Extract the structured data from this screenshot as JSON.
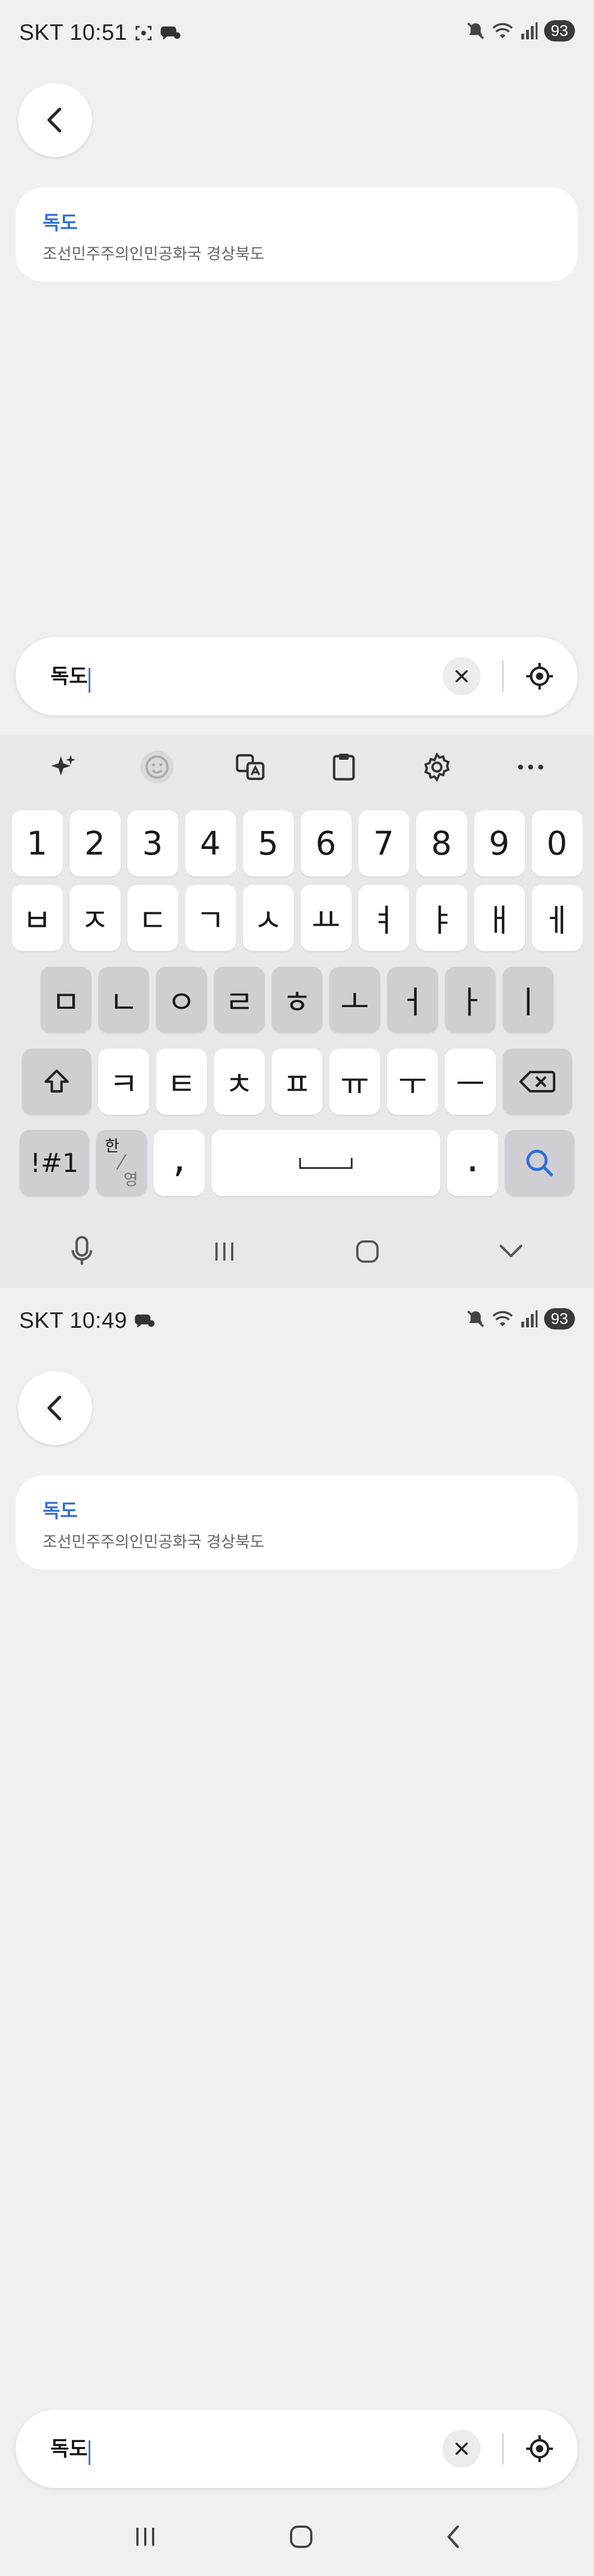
{
  "screen1": {
    "status": {
      "time": "SKT 10:51",
      "battery": "93"
    },
    "result": {
      "title": "독도",
      "subtitle": "조선민주주의인민공화국 경상북도"
    },
    "search": {
      "value": "독도"
    },
    "keyboard": {
      "toolbar": [
        "ai-sparkle-icon",
        "emoji-icon",
        "translate-icon",
        "clipboard-icon",
        "settings-icon",
        "more-icon"
      ],
      "row_numbers": [
        "1",
        "2",
        "3",
        "4",
        "5",
        "6",
        "7",
        "8",
        "9",
        "0"
      ],
      "row1": [
        "ㅂ",
        "ㅈ",
        "ㄷ",
        "ㄱ",
        "ㅅ",
        "ㅛ",
        "ㅕ",
        "ㅑ",
        "ㅐ",
        "ㅔ"
      ],
      "row2": [
        "ㅁ",
        "ㄴ",
        "ㅇ",
        "ㄹ",
        "ㅎ",
        "ㅗ",
        "ㅓ",
        "ㅏ",
        "ㅣ"
      ],
      "row3": [
        "ㅋ",
        "ㅌ",
        "ㅊ",
        "ㅍ",
        "ㅠ",
        "ㅜ",
        "ㅡ"
      ],
      "symbols_label": "!#1",
      "lang_top": "한",
      "lang_bottom": "영",
      "comma": ",",
      "period": "."
    }
  },
  "screen2": {
    "status": {
      "time": "SKT 10:49",
      "battery": "93"
    },
    "result": {
      "title": "독도",
      "subtitle": "조선민주주의인민공화국 경상북도"
    },
    "search": {
      "value": "독도"
    }
  },
  "colors": {
    "accent": "#2f6fd8",
    "background": "#f0f0f2",
    "keyboard_bg": "#e8e8ea"
  }
}
